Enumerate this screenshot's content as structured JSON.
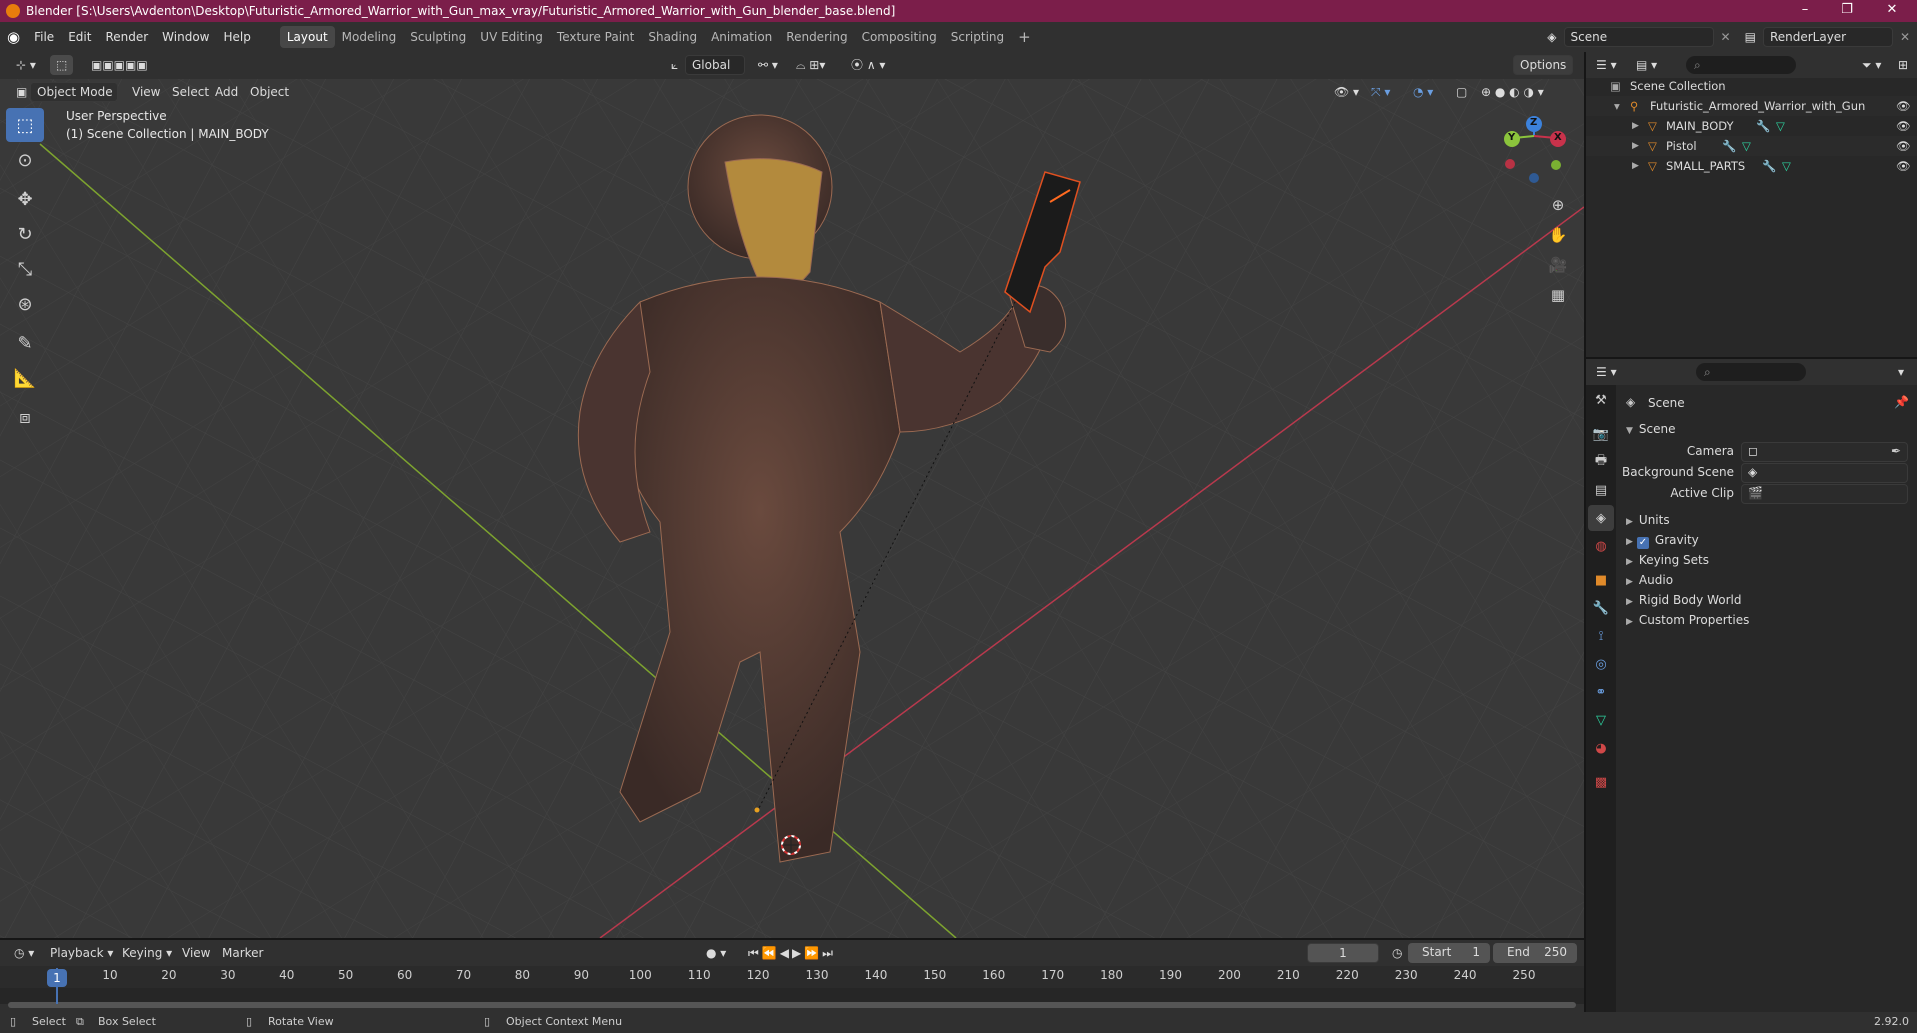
{
  "window": {
    "title": "Blender [S:\\Users\\Avdenton\\Desktop\\Futuristic_Armored_Warrior_with_Gun_max_vray/Futuristic_Armored_Warrior_with_Gun_blender_base.blend]",
    "minimize": "–",
    "maximize": "❐",
    "close": "✕"
  },
  "menu": [
    "File",
    "Edit",
    "Render",
    "Window",
    "Help"
  ],
  "workspaces": [
    "Layout",
    "Modeling",
    "Sculpting",
    "UV Editing",
    "Texture Paint",
    "Shading",
    "Animation",
    "Rendering",
    "Compositing",
    "Scripting"
  ],
  "active_workspace": "Layout",
  "add_workspace": "+",
  "scene_selector": "Scene",
  "view_layer": "RenderLayer",
  "viewport": {
    "mode": "Object Mode",
    "menus": [
      "View",
      "Select",
      "Add",
      "Object"
    ],
    "transform_orientation": "Global",
    "options": "Options",
    "overlay_line1": "User Perspective",
    "overlay_line2": "(1) Scene Collection | MAIN_BODY",
    "gizmo_axes": {
      "x": "X",
      "y": "Y",
      "z": "Z"
    },
    "colors": {
      "x_axis": "#c8324b",
      "y_axis": "#8bc43c",
      "z_axis": "#3c82dc",
      "grid_bg": "#393939",
      "accent": "#4772b3"
    }
  },
  "tools": [
    "select-box",
    "cursor",
    "move",
    "rotate",
    "scale",
    "transform",
    "annotate",
    "measure",
    "add-cube"
  ],
  "outliner": {
    "root": "Scene Collection",
    "collection": "Futuristic_Armored_Warrior_with_Gun",
    "objects": [
      "MAIN_BODY",
      "Pistol",
      "SMALL_PARTS"
    ]
  },
  "properties": {
    "context_title": "Scene",
    "panel_title": "Scene",
    "fields": {
      "camera": "Camera",
      "background_scene": "Background Scene",
      "active_clip": "Active Clip"
    },
    "sections": [
      "Units",
      "Gravity",
      "Keying Sets",
      "Audio",
      "Rigid Body World",
      "Custom Properties"
    ],
    "gravity_checked": true
  },
  "timeline": {
    "menus": [
      "Playback",
      "Keying",
      "View",
      "Marker"
    ],
    "current_frame": "1",
    "start_label": "Start",
    "start": "1",
    "end_label": "End",
    "end": "250",
    "ticks": [
      "1",
      "10",
      "20",
      "30",
      "40",
      "50",
      "60",
      "70",
      "80",
      "90",
      "100",
      "110",
      "120",
      "130",
      "140",
      "150",
      "160",
      "170",
      "180",
      "190",
      "200",
      "210",
      "220",
      "230",
      "240",
      "250"
    ]
  },
  "statusbar": {
    "select": "Select",
    "box_select": "Box Select",
    "rotate_view": "Rotate View",
    "context_menu": "Object Context Menu",
    "version": "2.92.0"
  }
}
